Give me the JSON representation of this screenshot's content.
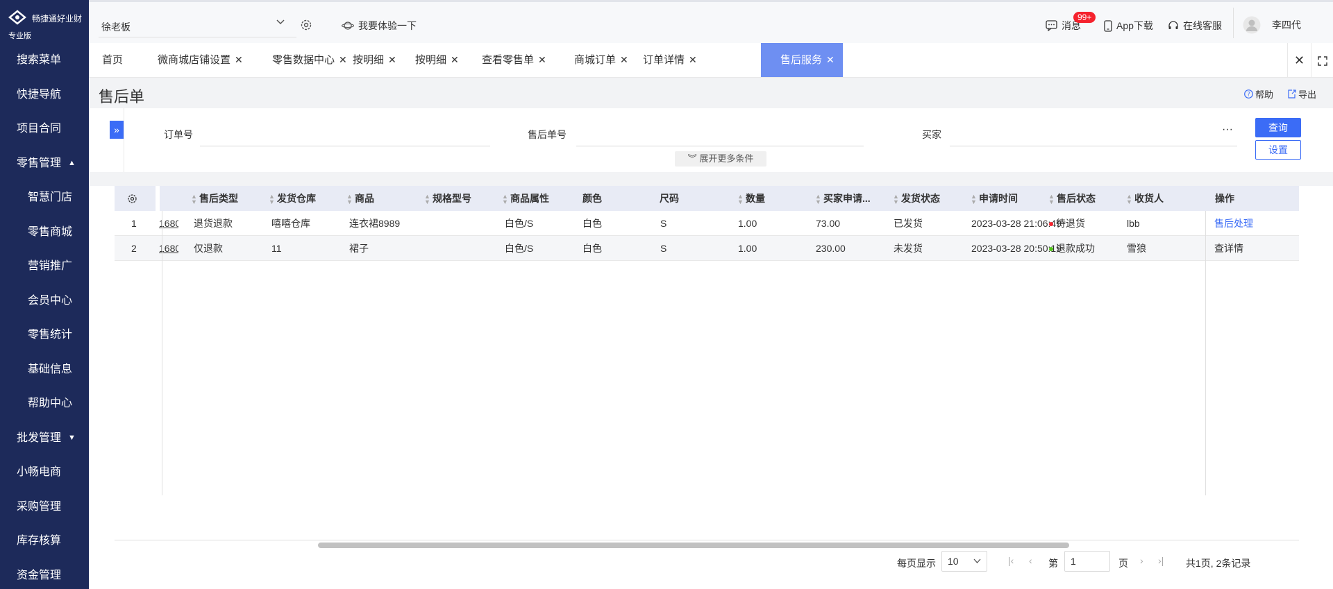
{
  "brand": {
    "name": "畅捷通好业财",
    "edition": "专业版"
  },
  "sidebar": {
    "items": [
      {
        "label": "搜索菜单",
        "sub": false
      },
      {
        "label": "快捷导航",
        "sub": false
      },
      {
        "label": "项目合同",
        "sub": false
      },
      {
        "label": "零售管理",
        "sub": false,
        "arrow": "▲"
      },
      {
        "label": "智慧门店",
        "sub": true
      },
      {
        "label": "零售商城",
        "sub": true
      },
      {
        "label": "营销推广",
        "sub": true
      },
      {
        "label": "会员中心",
        "sub": true
      },
      {
        "label": "零售统计",
        "sub": true
      },
      {
        "label": "基础信息",
        "sub": true
      },
      {
        "label": "帮助中心",
        "sub": true
      },
      {
        "label": "批发管理",
        "sub": false,
        "arrow": "▼"
      },
      {
        "label": "小畅电商",
        "sub": false
      },
      {
        "label": "采购管理",
        "sub": false
      },
      {
        "label": "库存核算",
        "sub": false
      },
      {
        "label": "资金管理",
        "sub": false
      }
    ]
  },
  "topbar": {
    "company": "徐老板",
    "try_label": "我要体验一下",
    "messages_label": "消息",
    "messages_badge": "99+",
    "app_label": "App下载",
    "service_label": "在线客服",
    "user_name": "李四代"
  },
  "tabs": [
    {
      "label": "首页",
      "closable": false,
      "active": false
    },
    {
      "label": "微商城店铺设置",
      "closable": true,
      "active": false
    },
    {
      "label": "零售数据中心",
      "closable": true,
      "active": false
    },
    {
      "label": "按明细",
      "closable": true,
      "active": false
    },
    {
      "label": "按明细",
      "closable": true,
      "active": false
    },
    {
      "label": "查看零售单",
      "closable": true,
      "active": false
    },
    {
      "label": "商城订单",
      "closable": true,
      "active": false
    },
    {
      "label": "订单详情",
      "closable": true,
      "active": false
    },
    {
      "label": "售后服务",
      "closable": true,
      "active": true
    }
  ],
  "page": {
    "title": "售后单",
    "help": "帮助",
    "export": "导出"
  },
  "filter": {
    "order_no_label": "订单号",
    "after_sale_no_label": "售后单号",
    "buyer_label": "买家",
    "more_icon": "···",
    "query_btn": "查询",
    "settings_btn": "设置",
    "more_conditions": "展开更多条件"
  },
  "table": {
    "columns": [
      "售后类型",
      "发货仓库",
      "商品",
      "规格型号",
      "商品属性",
      "颜色",
      "尺码",
      "数量",
      "买家申请...",
      "发货状态",
      "申请时间",
      "售后状态",
      "收货人",
      "操作"
    ],
    "rows": [
      {
        "idx": "1",
        "order": "1680",
        "type": "退货退款",
        "warehouse": "嘻嘻仓库",
        "product": "连衣裙8989",
        "spec": "",
        "attr": "白色/S",
        "color": "白色",
        "size": "S",
        "qty": "1.00",
        "amount": "73.00",
        "ship": "已发货",
        "time": "2023-03-28 21:06:49",
        "status": "待退货",
        "status_color": "#f5222d",
        "receiver": "lbb",
        "action": "售后处理",
        "action_link": true
      },
      {
        "idx": "2",
        "order": "1680",
        "type": "仅退款",
        "warehouse": "11",
        "product": "裙子",
        "spec": "",
        "attr": "白色/S",
        "color": "白色",
        "size": "S",
        "qty": "1.00",
        "amount": "230.00",
        "ship": "未发货",
        "time": "2023-03-28 20:50:19",
        "status": "退款成功",
        "status_color": "#52c41a",
        "receiver": "雪狼",
        "action": "查详情",
        "action_link": false
      }
    ]
  },
  "pager": {
    "per_page_label": "每页显示",
    "per_page": "10",
    "page_prefix": "第",
    "page_value": "1",
    "page_suffix": "页",
    "summary": "共1页, 2条记录"
  }
}
